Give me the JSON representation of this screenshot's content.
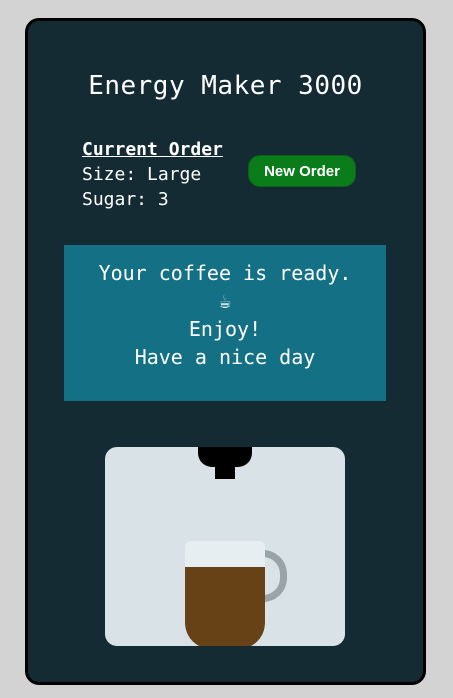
{
  "app": {
    "title": "Energy Maker 3000"
  },
  "order": {
    "heading": "Current Order",
    "size_line": "Size: Large",
    "sugar_line": "Sugar: 3"
  },
  "actions": {
    "new_order_label": "New Order"
  },
  "status": {
    "line1": "Your coffee is ready.",
    "emoji": "☕",
    "line2": "Enjoy!",
    "line3": "Have a nice day"
  },
  "colors": {
    "page_bg": "#d3d3d3",
    "machine_bg": "#142b34",
    "status_bg": "#137085",
    "button_bg": "#0a7d1a",
    "dispenser_bg": "#d9e2e7",
    "coffee": "#664216"
  },
  "mug": {
    "fill_fraction": 0.76
  }
}
